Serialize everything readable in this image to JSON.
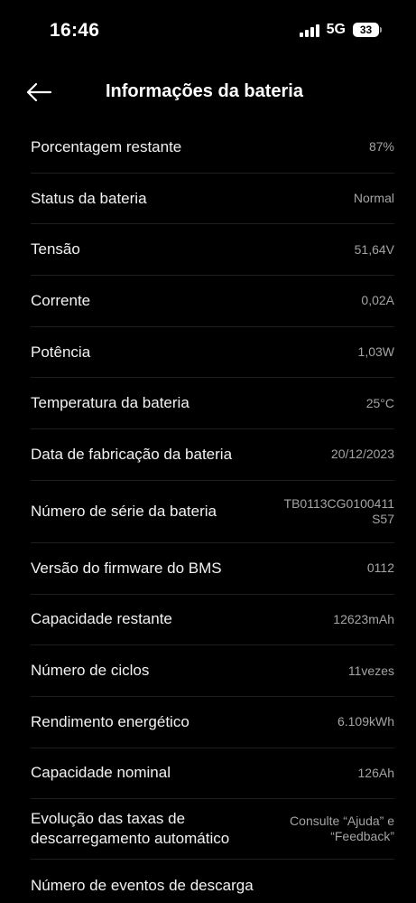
{
  "status_bar": {
    "time": "16:46",
    "network": "5G",
    "battery_level": "33"
  },
  "header": {
    "title": "Informações da bateria",
    "back_icon": "arrow-left-icon"
  },
  "rows": [
    {
      "label": "Porcentagem restante",
      "value": "87%"
    },
    {
      "label": "Status da bateria",
      "value": "Normal"
    },
    {
      "label": "Tensão",
      "value": "51,64V"
    },
    {
      "label": "Corrente",
      "value": "0,02A"
    },
    {
      "label": "Potência",
      "value": "1,03W"
    },
    {
      "label": "Temperatura da bateria",
      "value": "25°C"
    },
    {
      "label": "Data de fabricação da bateria",
      "value": "20/12/2023"
    },
    {
      "label": "Número de série da bateria",
      "value": "TB0113CG0100411 S57"
    },
    {
      "label": "Versão do firmware do BMS",
      "value": "0112"
    },
    {
      "label": "Capacidade restante",
      "value": "12623mAh"
    },
    {
      "label": "Número de ciclos",
      "value": "11vezes"
    },
    {
      "label": "Rendimento energético",
      "value": "6.109kWh"
    },
    {
      "label": "Capacidade nominal",
      "value": "126Ah"
    },
    {
      "label": "Evolução das taxas de descarregamento automático",
      "value": "Consulte “Ajuda” e “Feedback”"
    },
    {
      "label": "Número de eventos de descarga",
      "value": ""
    }
  ],
  "colors": {
    "background": "#000000",
    "label": "#f2f2f2",
    "value": "#a4a4a4",
    "divider": "#1f1f1f"
  }
}
